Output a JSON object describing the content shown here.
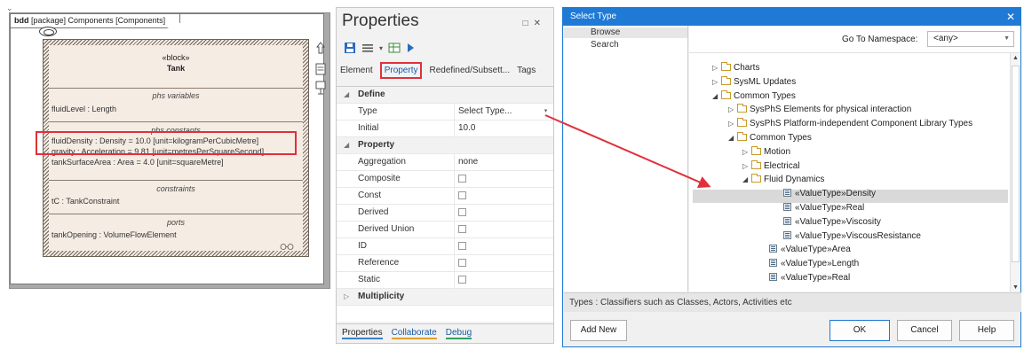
{
  "diagram": {
    "frame_label_kind": "bdd",
    "frame_label_rest": "[package] Components [Components]",
    "block": {
      "stereotype": "«block»",
      "name": "Tank",
      "compartments": [
        {
          "header": "phs variables",
          "rows": [
            "fluidLevel : Length"
          ]
        },
        {
          "header": "phs constants",
          "rows": [
            "fluidDensity : Density = 10.0 [unit=kilogramPerCubicMetre]",
            "gravity : Acceleration = 9.81 [unit=metresPerSquareSecond]",
            "tankSurfaceArea : Area = 4.0 [unit=squareMetre]"
          ]
        },
        {
          "header": "constraints",
          "rows": [
            "tC : TankConstraint"
          ]
        },
        {
          "header": "ports",
          "rows": [
            "tankOpening : VolumeFlowElement"
          ]
        }
      ]
    },
    "highlight_color": "#e0303b"
  },
  "properties": {
    "title": "Properties",
    "window_buttons": [
      "□",
      "✕"
    ],
    "toolbar_icons": [
      "save-icon",
      "list-icon",
      "grid-icon",
      "play-icon"
    ],
    "tabs": [
      "Element",
      "Property",
      "Redefined/Subsett...",
      "Tags"
    ],
    "active_tab": "Property",
    "groups": {
      "define": "Define",
      "property": "Property",
      "multiplicity": "Multiplicity"
    },
    "rows": {
      "type": {
        "label": "Type",
        "value": "Select Type..."
      },
      "initial": {
        "label": "Initial",
        "value": "10.0"
      },
      "aggregation": {
        "label": "Aggregation",
        "value": "none"
      },
      "composite": {
        "label": "Composite"
      },
      "const": {
        "label": "Const"
      },
      "derived": {
        "label": "Derived"
      },
      "derived_union": {
        "label": "Derived Union"
      },
      "id": {
        "label": "ID"
      },
      "reference": {
        "label": "Reference"
      },
      "static": {
        "label": "Static"
      }
    },
    "bottom_tabs": [
      "Properties",
      "Collaborate",
      "Debug"
    ]
  },
  "select_type": {
    "title": "Select Type",
    "left_items": [
      "Browse",
      "Search"
    ],
    "namespace_label": "Go To Namespace:",
    "namespace_value": "<any>",
    "tree": [
      {
        "label": "Charts",
        "kind": "folder",
        "exp": "▷"
      },
      {
        "label": "SysML Updates",
        "kind": "folder",
        "exp": "▷"
      },
      {
        "label": "Common Types",
        "kind": "folder",
        "exp": "◢"
      },
      {
        "label": "SysPhS Elements for physical interaction",
        "kind": "folder",
        "exp": "▷"
      },
      {
        "label": "SysPhS Platform-independent Component Library Types",
        "kind": "folder",
        "exp": "▷"
      },
      {
        "label": "Common Types",
        "kind": "folder",
        "exp": "◢"
      },
      {
        "label": "Motion",
        "kind": "folder",
        "exp": "▷"
      },
      {
        "label": "Electrical",
        "kind": "folder",
        "exp": "▷"
      },
      {
        "label": "Fluid Dynamics",
        "kind": "folder",
        "exp": "◢"
      },
      {
        "label": "«ValueType»Density",
        "kind": "valuetype",
        "exp": "",
        "selected": true
      },
      {
        "label": "«ValueType»Real",
        "kind": "valuetype",
        "exp": ""
      },
      {
        "label": "«ValueType»Viscosity",
        "kind": "valuetype",
        "exp": ""
      },
      {
        "label": "«ValueType»ViscousResistance",
        "kind": "valuetype",
        "exp": ""
      },
      {
        "label": "«ValueType»Area",
        "kind": "valuetype",
        "exp": ""
      },
      {
        "label": "«ValueType»Length",
        "kind": "valuetype",
        "exp": ""
      },
      {
        "label": "«ValueType»Real",
        "kind": "valuetype",
        "exp": ""
      }
    ],
    "status": "Types : Classifiers such as Classes, Actors, Activities etc",
    "buttons": {
      "add_new": "Add New",
      "ok": "OK",
      "cancel": "Cancel",
      "help": "Help"
    }
  },
  "colors": {
    "accent": "#1f7ad6",
    "highlight": "#e0303b",
    "arrow": "#e0303b"
  }
}
